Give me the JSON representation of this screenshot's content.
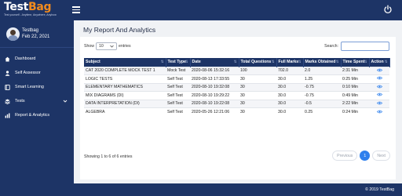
{
  "brand": {
    "name_part1": "Test",
    "name_part2": "Bag",
    "tagline": "Test yourself - Anytime, Anywhere, Anyhow",
    "accent_color": "#f28b1e",
    "primary_color": "#1d3466"
  },
  "header": {
    "menu_icon": "hamburger-icon",
    "power_icon": "power-icon"
  },
  "user": {
    "name": "Testbag",
    "date": "Feb 22, 2021"
  },
  "sidebar": {
    "items": [
      {
        "label": "Dashboard",
        "icon": "home-icon"
      },
      {
        "label": "Self Assessor",
        "icon": "user-icon"
      },
      {
        "label": "Smart Learning",
        "icon": "book-icon"
      },
      {
        "label": "Tests",
        "icon": "tests-icon",
        "has_chevron": true
      },
      {
        "label": "Report & Analytics",
        "icon": "chart-icon"
      }
    ]
  },
  "main": {
    "title": "My Report And Analytics",
    "show_label": "Show",
    "entries_value": "10",
    "entries_label": "entries",
    "search_label": "Search:",
    "search_value": "",
    "table": {
      "columns": [
        "Subject",
        "Test Type",
        "Date",
        "Total Questions",
        "Full Marks",
        "Marks Obtained",
        "Time Spent",
        "Action"
      ],
      "rows": [
        [
          "CAT 2020 COMPLETE MOCK TEST 1",
          "Mock Test",
          "2020-08-06 15:32:16",
          "100",
          "702.0",
          "2.0",
          "2:31 Min",
          ""
        ],
        [
          "LOGIC TESTS",
          "Self Test",
          "2020-08-13 17:33:55",
          "30",
          "30.0",
          "1.25",
          "0:25 Min",
          ""
        ],
        [
          "ELEMENTARY MATHEMATICS",
          "Self Test",
          "2020-08-10 19:32:08",
          "30",
          "30.0",
          "-0.75",
          "0:10 Min",
          ""
        ],
        [
          "MIX DIAGRAMS (DI)",
          "Self Test",
          "2020-08-10 19:29:22",
          "30",
          "30.0",
          "-0.75",
          "0:49 Min",
          ""
        ],
        [
          "DATA INTERPRETATION (DI)",
          "Self Test",
          "2020-08-10 19:22:08",
          "30",
          "30.0",
          "-0.5",
          "2:22 Min",
          ""
        ],
        [
          "ALGEBRA",
          "Self Test",
          "2020-05-26 12:21:06",
          "30",
          "30.0",
          "0.25",
          "0:24 Min",
          ""
        ]
      ]
    },
    "info": "Showing 1 to 6 of 6 entries",
    "pagination": {
      "previous": "Previous",
      "current": "1",
      "next": "Next",
      "active_color": "#2f80ed"
    }
  },
  "footer": {
    "text": "© 2019 TestBag"
  }
}
